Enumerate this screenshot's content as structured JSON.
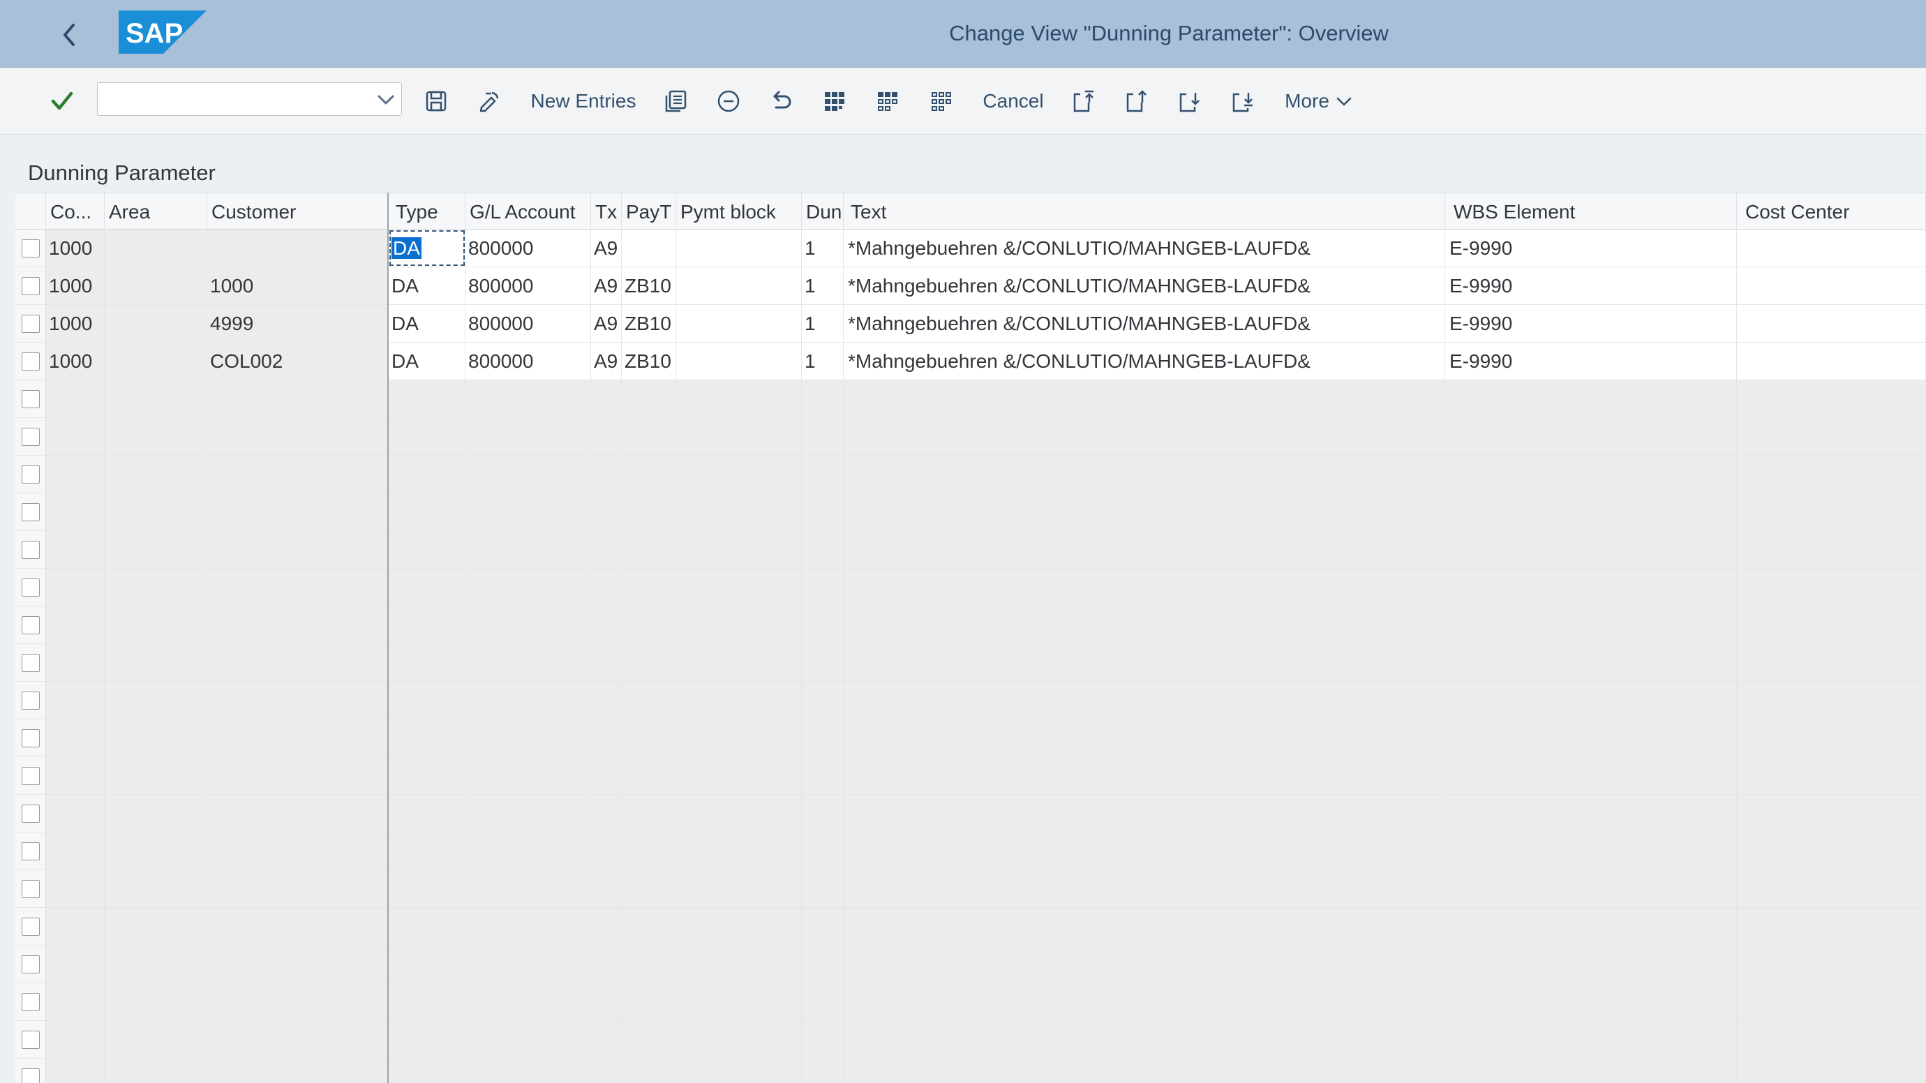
{
  "shell": {
    "title": "Change View \"Dunning Parameter\": Overview",
    "logo_text": "SAP"
  },
  "toolbar": {
    "command_field": {
      "value": "",
      "placeholder": ""
    },
    "new_entries_label": "New Entries",
    "cancel_label": "Cancel",
    "more_label": "More"
  },
  "section": {
    "title": "Dunning Parameter"
  },
  "table": {
    "columns": [
      "Co...",
      "Area",
      "Customer",
      "Type",
      "G/L Account",
      "Tx",
      "PayT",
      "Pymt block",
      "Dun",
      "Text",
      "WBS Element",
      "Cost Center"
    ],
    "rows": [
      {
        "co": "1000",
        "area": "",
        "customer": "",
        "type": "DA",
        "gl": "800000",
        "tx": "A9",
        "payt": "",
        "block": "",
        "dun": "1",
        "text": "*Mahngebuehren &/CONLUTIO/MAHNGEB-LAUFD&",
        "wbs": "E-9990",
        "cc": ""
      },
      {
        "co": "1000",
        "area": "",
        "customer": "1000",
        "type": "DA",
        "gl": "800000",
        "tx": "A9",
        "payt": "ZB10",
        "block": "",
        "dun": "1",
        "text": "*Mahngebuehren &/CONLUTIO/MAHNGEB-LAUFD&",
        "wbs": "E-9990",
        "cc": ""
      },
      {
        "co": "1000",
        "area": "",
        "customer": "4999",
        "type": "DA",
        "gl": "800000",
        "tx": "A9",
        "payt": "ZB10",
        "block": "",
        "dun": "1",
        "text": "*Mahngebuehren &/CONLUTIO/MAHNGEB-LAUFD&",
        "wbs": "E-9990",
        "cc": ""
      },
      {
        "co": "1000",
        "area": "",
        "customer": "COL002",
        "type": "DA",
        "gl": "800000",
        "tx": "A9",
        "payt": "ZB10",
        "block": "",
        "dun": "1",
        "text": "*Mahngebuehren &/CONLUTIO/MAHNGEB-LAUFD&",
        "wbs": "E-9990",
        "cc": ""
      }
    ]
  },
  "colors": {
    "shell": "#a8c1d9",
    "accent": "#0a6ed1",
    "check": "#2b7d2b"
  }
}
